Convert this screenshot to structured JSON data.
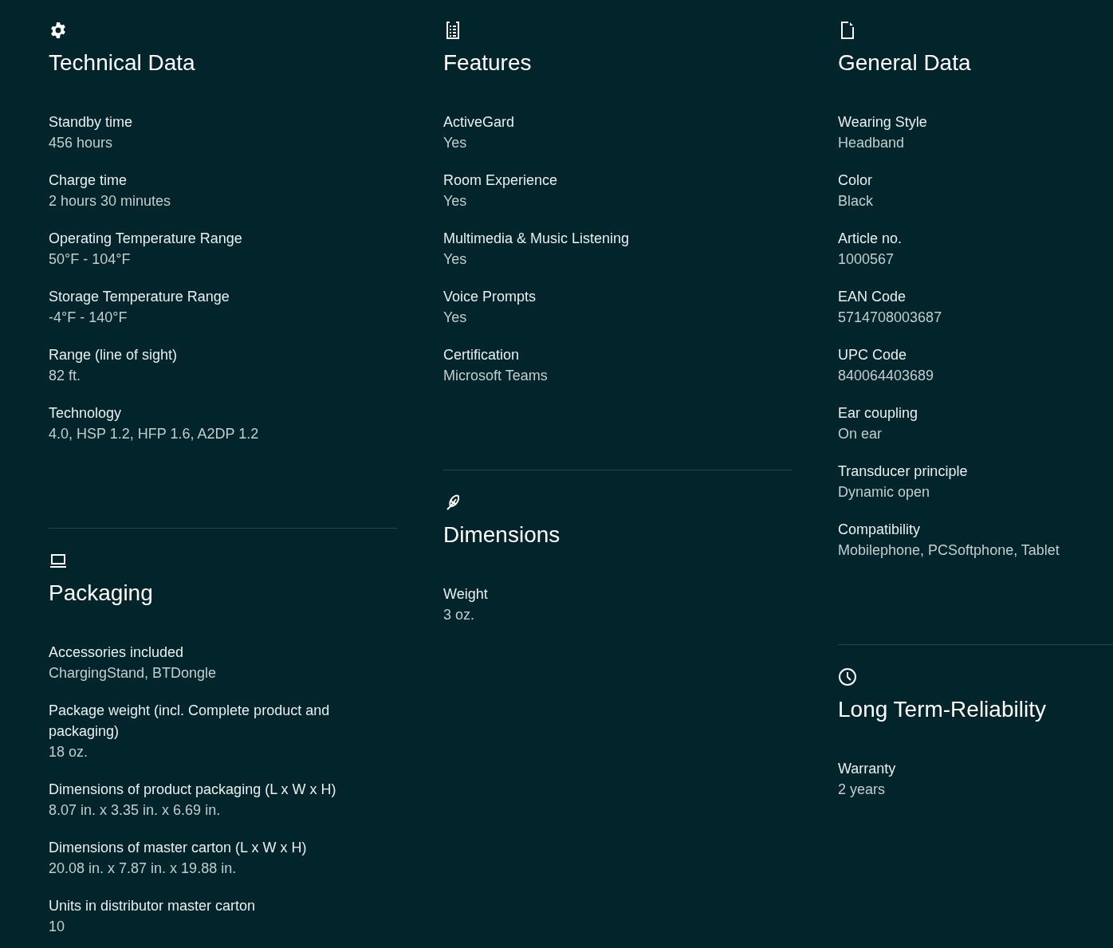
{
  "columns": [
    {
      "sections": [
        {
          "kind": "gear",
          "title": "Technical Data",
          "items": [
            {
              "label": "Standby time",
              "value": "456 hours"
            },
            {
              "label": "Charge time",
              "value": "2 hours 30 minutes"
            },
            {
              "label": "Operating Temperature Range",
              "value": "50°F - 104°F"
            },
            {
              "label": "Storage Temperature Range",
              "value": "-4°F - 140°F"
            },
            {
              "label": "Range (line of sight)",
              "value": "82 ft."
            },
            {
              "label": "Technology",
              "value": "4.0, HSP 1.2, HFP 1.6, A2DP 1.2"
            }
          ]
        },
        {
          "kind": "laptop",
          "title": "Packaging",
          "items": [
            {
              "label": "Accessories included",
              "value": "ChargingStand, BTDongle"
            },
            {
              "label": "Package weight (incl. Complete product and packaging)",
              "value": "18 oz."
            },
            {
              "label": "Dimensions of product packaging (L x W x H)",
              "value": "8.07 in. x 3.35 in. x 6.69 in."
            },
            {
              "label": "Dimensions of master carton (L x W x H)",
              "value": "20.08 in. x 7.87 in. x 19.88 in."
            },
            {
              "label": "Units in distributor master carton",
              "value": "10"
            }
          ]
        }
      ]
    },
    {
      "sections": [
        {
          "kind": "list",
          "title": "Features",
          "items": [
            {
              "label": "ActiveGard",
              "value": "Yes"
            },
            {
              "label": "Room Experience",
              "value": "Yes"
            },
            {
              "label": "Multimedia & Music Listening",
              "value": "Yes"
            },
            {
              "label": "Voice Prompts",
              "value": "Yes"
            },
            {
              "label": "Certification",
              "value": "Microsoft Teams"
            }
          ]
        },
        {
          "kind": "feather",
          "title": "Dimensions",
          "items": [
            {
              "label": "Weight",
              "value": "3 oz."
            }
          ]
        }
      ]
    },
    {
      "sections": [
        {
          "kind": "document",
          "title": "General Data",
          "items": [
            {
              "label": "Wearing Style",
              "value": "Headband"
            },
            {
              "label": "Color",
              "value": "Black"
            },
            {
              "label": "Article no.",
              "value": "1000567"
            },
            {
              "label": "EAN Code",
              "value": "5714708003687"
            },
            {
              "label": "UPC Code",
              "value": "840064403689"
            },
            {
              "label": "Ear coupling",
              "value": "On ear"
            },
            {
              "label": "Transducer principle",
              "value": "Dynamic open"
            },
            {
              "label": "Compatibility",
              "value": "Mobilephone, PCSoftphone, Tablet"
            }
          ]
        },
        {
          "kind": "clock",
          "title": "Long Term-Reliability",
          "items": [
            {
              "label": "Warranty",
              "value": "2 years"
            }
          ]
        }
      ]
    }
  ]
}
